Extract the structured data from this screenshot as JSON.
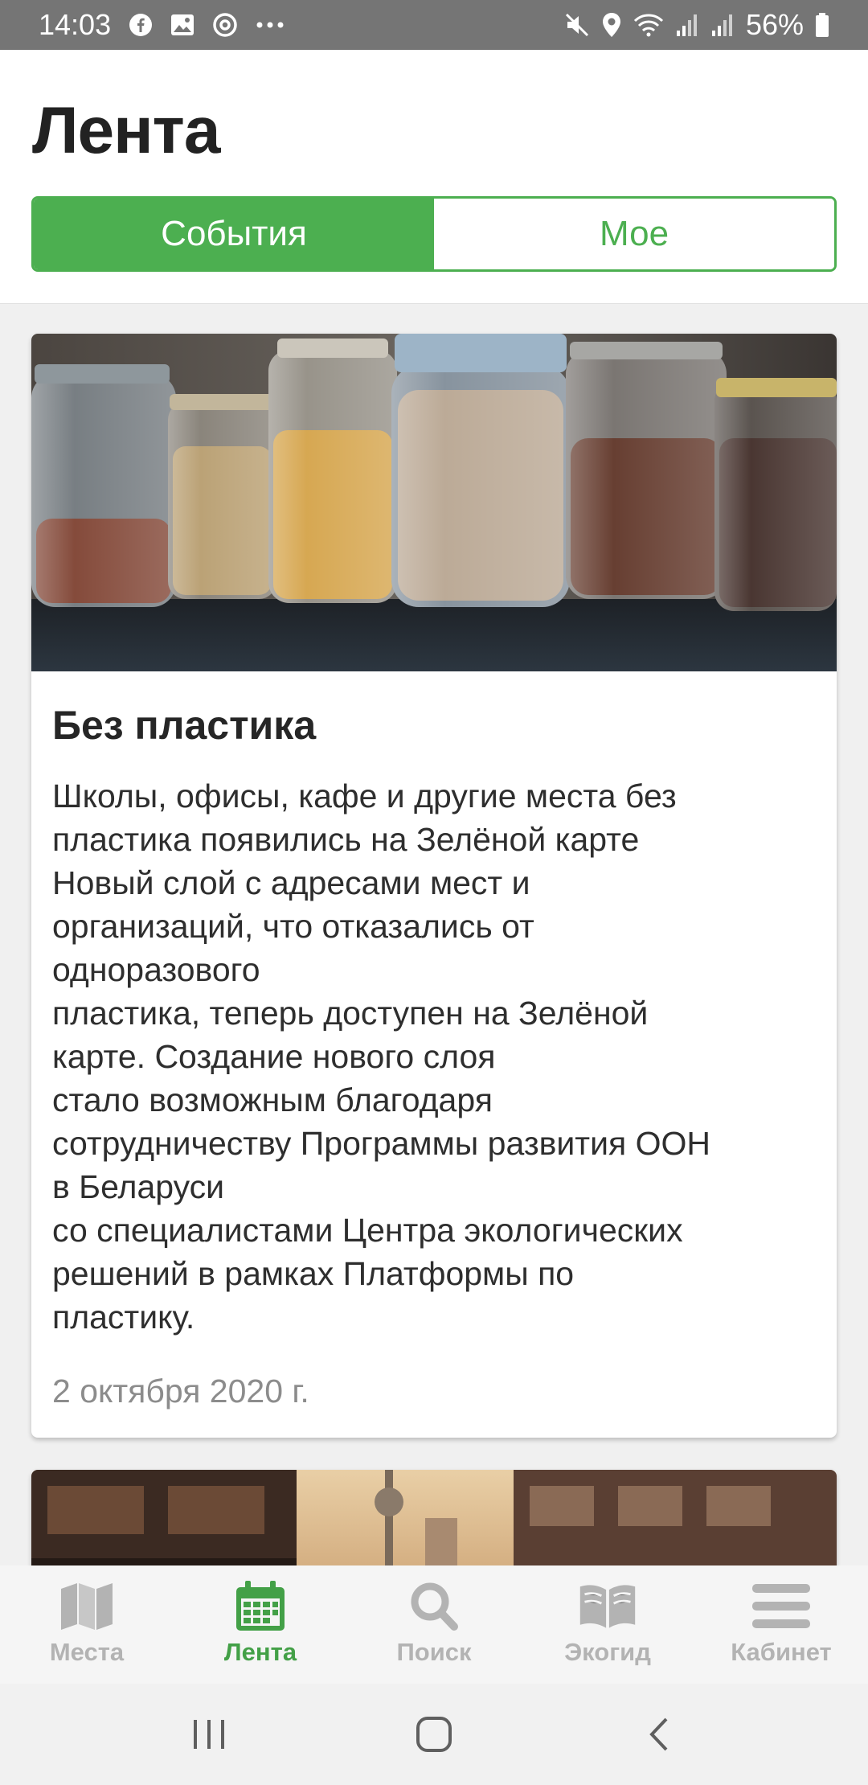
{
  "status_bar": {
    "time": "14:03",
    "battery": "56%",
    "left_icons": [
      "facebook-icon",
      "gallery-icon",
      "at-icon",
      "more-icon"
    ],
    "right_icons": [
      "mute-icon",
      "location-icon",
      "wifi-icon",
      "signal-icon",
      "signal-icon",
      "battery-icon"
    ]
  },
  "header": {
    "title": "Лента",
    "tabs": [
      {
        "label": "События",
        "active": true
      },
      {
        "label": "Мое",
        "active": false
      }
    ]
  },
  "feed": {
    "cards": [
      {
        "title": "Без пластика",
        "text_lines": [
          "Школы, офисы, кафе и другие места без",
          "пластика появились на Зелёной карте",
          "Новый слой с адресами мест и",
          "организаций, что отказались от",
          "одноразового",
          "пластика, теперь доступен на Зелёной",
          "карте. Создание нового слоя",
          "стало возможным благодаря",
          "сотрудничеству Программы развития ООН",
          "в Беларуси",
          "со специалистами Центра экологических",
          "решений в рамках Платформы по",
          "пластику."
        ],
        "date": "2 октября 2020 г."
      }
    ]
  },
  "bottom_nav": {
    "items": [
      {
        "label": "Места",
        "icon": "map-icon",
        "active": false
      },
      {
        "label": "Лента",
        "icon": "calendar-icon",
        "active": true
      },
      {
        "label": "Поиск",
        "icon": "search-icon",
        "active": false
      },
      {
        "label": "Экогид",
        "icon": "book-icon",
        "active": false
      },
      {
        "label": "Кабинет",
        "icon": "menu-icon",
        "active": false
      }
    ]
  },
  "colors": {
    "accent": "#4caf50",
    "status_bar": "#757575",
    "nav_inactive": "#b3b3b3",
    "nav_active": "#43a047"
  }
}
